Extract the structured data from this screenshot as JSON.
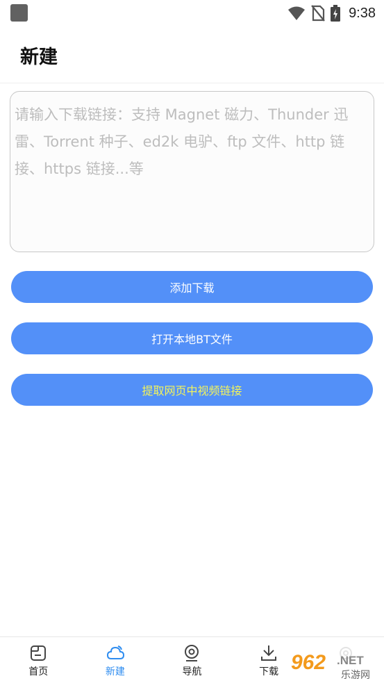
{
  "status_bar": {
    "time": "9:38"
  },
  "header": {
    "title": "新建"
  },
  "link_input": {
    "value": "",
    "placeholder": "请输入下载链接：支持 Magnet 磁力、Thunder 迅雷、Torrent 种子、ed2k 电驴、ftp 文件、http 链接、https 链接...等"
  },
  "actions": {
    "add_download": "添加下载",
    "open_bt": "打开本地BT文件",
    "extract_video": "提取网页中视频链接"
  },
  "nav": {
    "items": [
      {
        "label": "首页",
        "icon": "home-icon"
      },
      {
        "label": "新建",
        "icon": "cloud-icon",
        "active": true
      },
      {
        "label": "导航",
        "icon": "compass-icon"
      },
      {
        "label": "下载",
        "icon": "download-icon"
      },
      {
        "label": "",
        "icon": "settings-icon"
      }
    ]
  },
  "watermark": {
    "number": "962",
    "suffix": ".NET",
    "site": "乐游网"
  },
  "colors": {
    "accent": "#5390f8",
    "active_nav": "#2f8df0",
    "extract_text": "#f4f45a"
  }
}
